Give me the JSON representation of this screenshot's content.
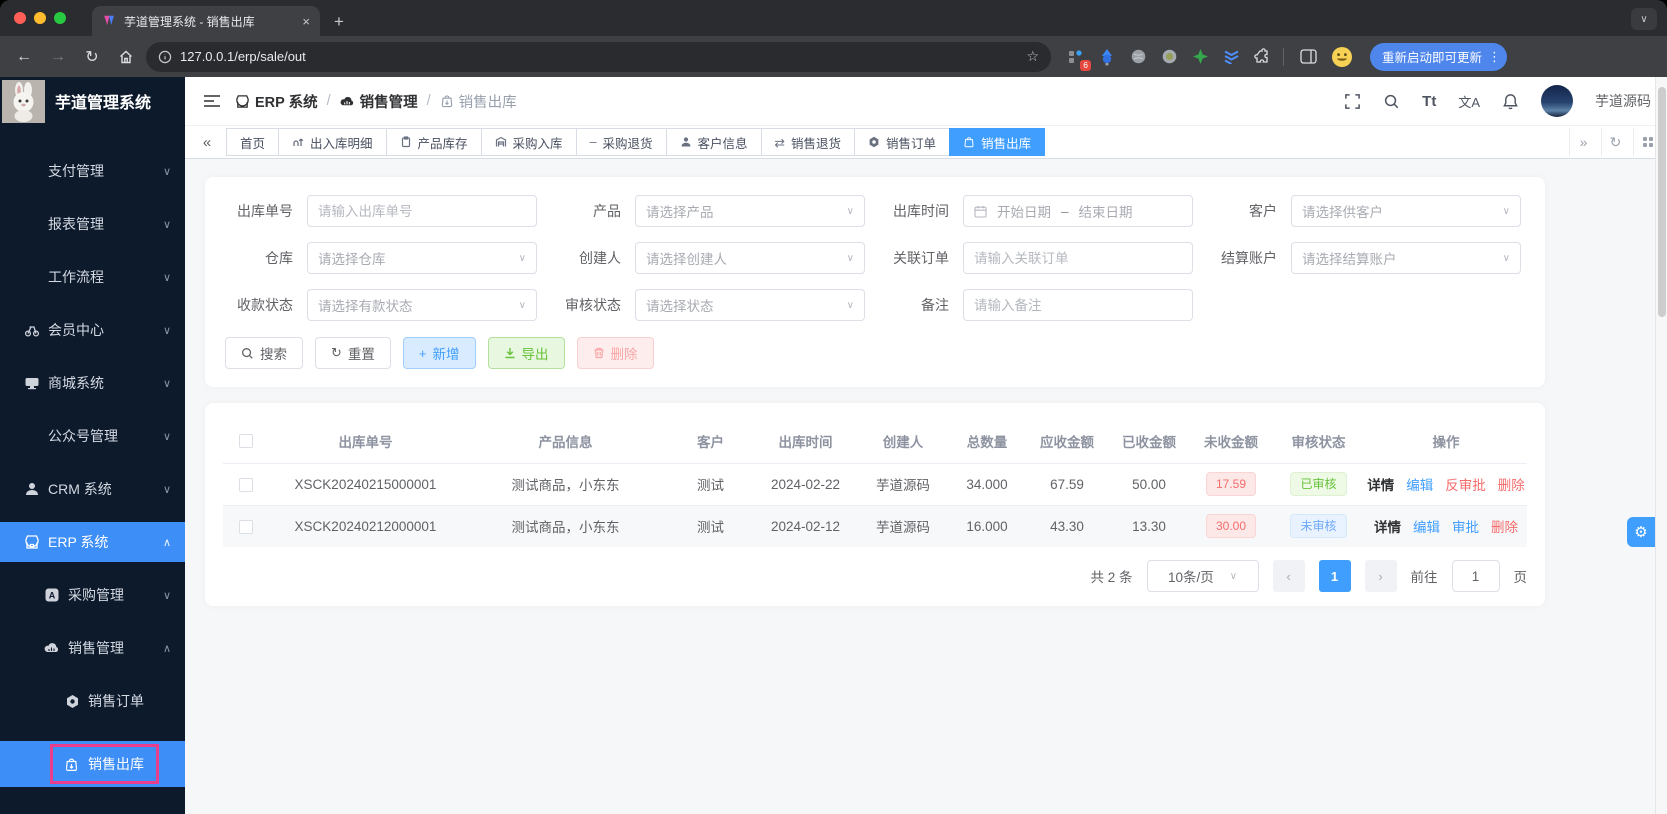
{
  "browser": {
    "tab_title": "芋道管理系统 - 销售出库",
    "url": "127.0.0.1/erp/sale/out",
    "ext_badge": "6",
    "update_button": "重新启动即可更新"
  },
  "icons": {
    "close": "×",
    "plus": "+",
    "kebab": "⋮",
    "back": "←",
    "forward": "→",
    "refresh": "↻",
    "star": "☆",
    "tab_search": "∨",
    "collapse_left": "«",
    "expand_right": "»",
    "chev_down": "∨",
    "chev_up": "∧",
    "gear": "⚙",
    "minus": "–",
    "swap": "⇄",
    "font": "Tt",
    "lang": "文A",
    "prev": "‹",
    "next": "›"
  },
  "sidebar": {
    "title": "芋道管理系统",
    "items": [
      {
        "label": "支付管理"
      },
      {
        "label": "报表管理"
      },
      {
        "label": "工作流程"
      },
      {
        "label": "会员中心"
      },
      {
        "label": "商城系统"
      },
      {
        "label": "公众号管理"
      },
      {
        "label": "CRM 系统"
      },
      {
        "label": "ERP 系统"
      },
      {
        "label": "采购管理"
      },
      {
        "label": "销售管理"
      },
      {
        "label": "销售订单"
      },
      {
        "label": "销售出库"
      }
    ]
  },
  "header": {
    "breadcrumb": [
      "ERP 系统",
      "销售管理",
      "销售出库"
    ],
    "username": "芋道源码"
  },
  "tags": [
    "首页",
    "出入库明细",
    "产品库存",
    "采购入库",
    "采购退货",
    "客户信息",
    "销售退货",
    "销售订单",
    "销售出库"
  ],
  "filters": {
    "fields": [
      {
        "label": "出库单号",
        "placeholder": "请输入出库单号"
      },
      {
        "label": "产品",
        "placeholder": "请选择产品"
      },
      {
        "label": "出库时间",
        "start": "开始日期",
        "sep": "–",
        "end": "结束日期"
      },
      {
        "label": "客户",
        "placeholder": "请选择供客户"
      },
      {
        "label": "仓库",
        "placeholder": "请选择仓库"
      },
      {
        "label": "创建人",
        "placeholder": "请选择创建人"
      },
      {
        "label": "关联订单",
        "placeholder": "请输入关联订单"
      },
      {
        "label": "结算账户",
        "placeholder": "请选择结算账户"
      },
      {
        "label": "收款状态",
        "placeholder": "请选择有款状态"
      },
      {
        "label": "审核状态",
        "placeholder": "请选择状态"
      },
      {
        "label": "备注",
        "placeholder": "请输入备注"
      }
    ],
    "buttons": {
      "search": "搜索",
      "reset": "重置",
      "add": "新增",
      "export": "导出",
      "delete": "删除"
    }
  },
  "table": {
    "columns": [
      "出库单号",
      "产品信息",
      "客户",
      "出库时间",
      "创建人",
      "总数量",
      "应收金额",
      "已收金额",
      "未收金额",
      "审核状态",
      "操作"
    ],
    "rows": [
      {
        "no": "XSCK20240215000001",
        "product": "测试商品，小东东",
        "customer": "测试",
        "time": "2024-02-22",
        "creator": "芋道源码",
        "qty": "34.000",
        "receivable": "67.59",
        "received": "50.00",
        "unreceived": "17.59",
        "status": "已审核",
        "actions": [
          "详情",
          "编辑",
          "反审批",
          "删除"
        ]
      },
      {
        "no": "XSCK20240212000001",
        "product": "测试商品，小东东",
        "customer": "测试",
        "time": "2024-02-12",
        "creator": "芋道源码",
        "qty": "16.000",
        "receivable": "43.30",
        "received": "13.30",
        "unreceived": "30.00",
        "status": "未审核",
        "actions": [
          "详情",
          "编辑",
          "审批",
          "删除"
        ]
      }
    ]
  },
  "pagination": {
    "total": "共 2 条",
    "page_size": "10条/页",
    "page": "1",
    "goto": "前往",
    "goto_value": "1",
    "unit": "页"
  },
  "colors": {
    "accent": "#409eff",
    "success": "#67c23a",
    "danger": "#f56c6c",
    "highlight": "#e83e8c",
    "sidebar": "#0c1a2c"
  }
}
